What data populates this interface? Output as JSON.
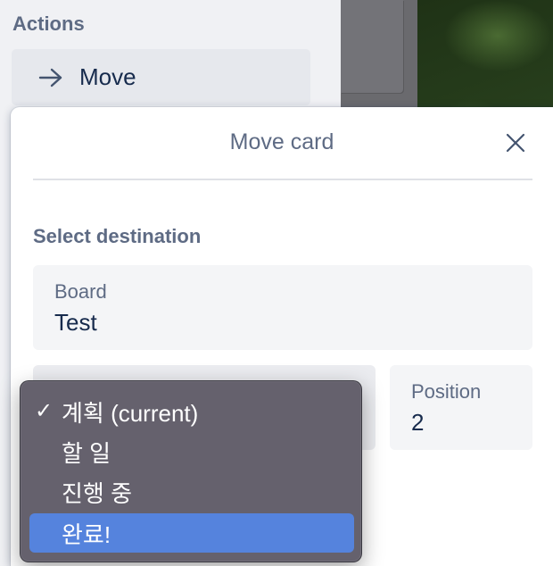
{
  "actions": {
    "heading": "Actions",
    "move_label": "Move"
  },
  "popover": {
    "title": "Move card",
    "section_label": "Select destination",
    "board": {
      "label": "Board",
      "value": "Test"
    },
    "position": {
      "label": "Position",
      "value": "2"
    }
  },
  "dropdown": {
    "options": [
      {
        "label": "계획 (current)",
        "checked": true
      },
      {
        "label": "할 일"
      },
      {
        "label": "진행 중"
      },
      {
        "label": "완료!",
        "highlighted": true
      }
    ]
  },
  "icons": {
    "move": "arrow-right-icon",
    "close": "close-icon",
    "check": "checkmark-icon"
  },
  "colors": {
    "accent_highlight": "#5583dd",
    "text_primary": "#172b4d",
    "text_secondary": "#5e6b84"
  }
}
